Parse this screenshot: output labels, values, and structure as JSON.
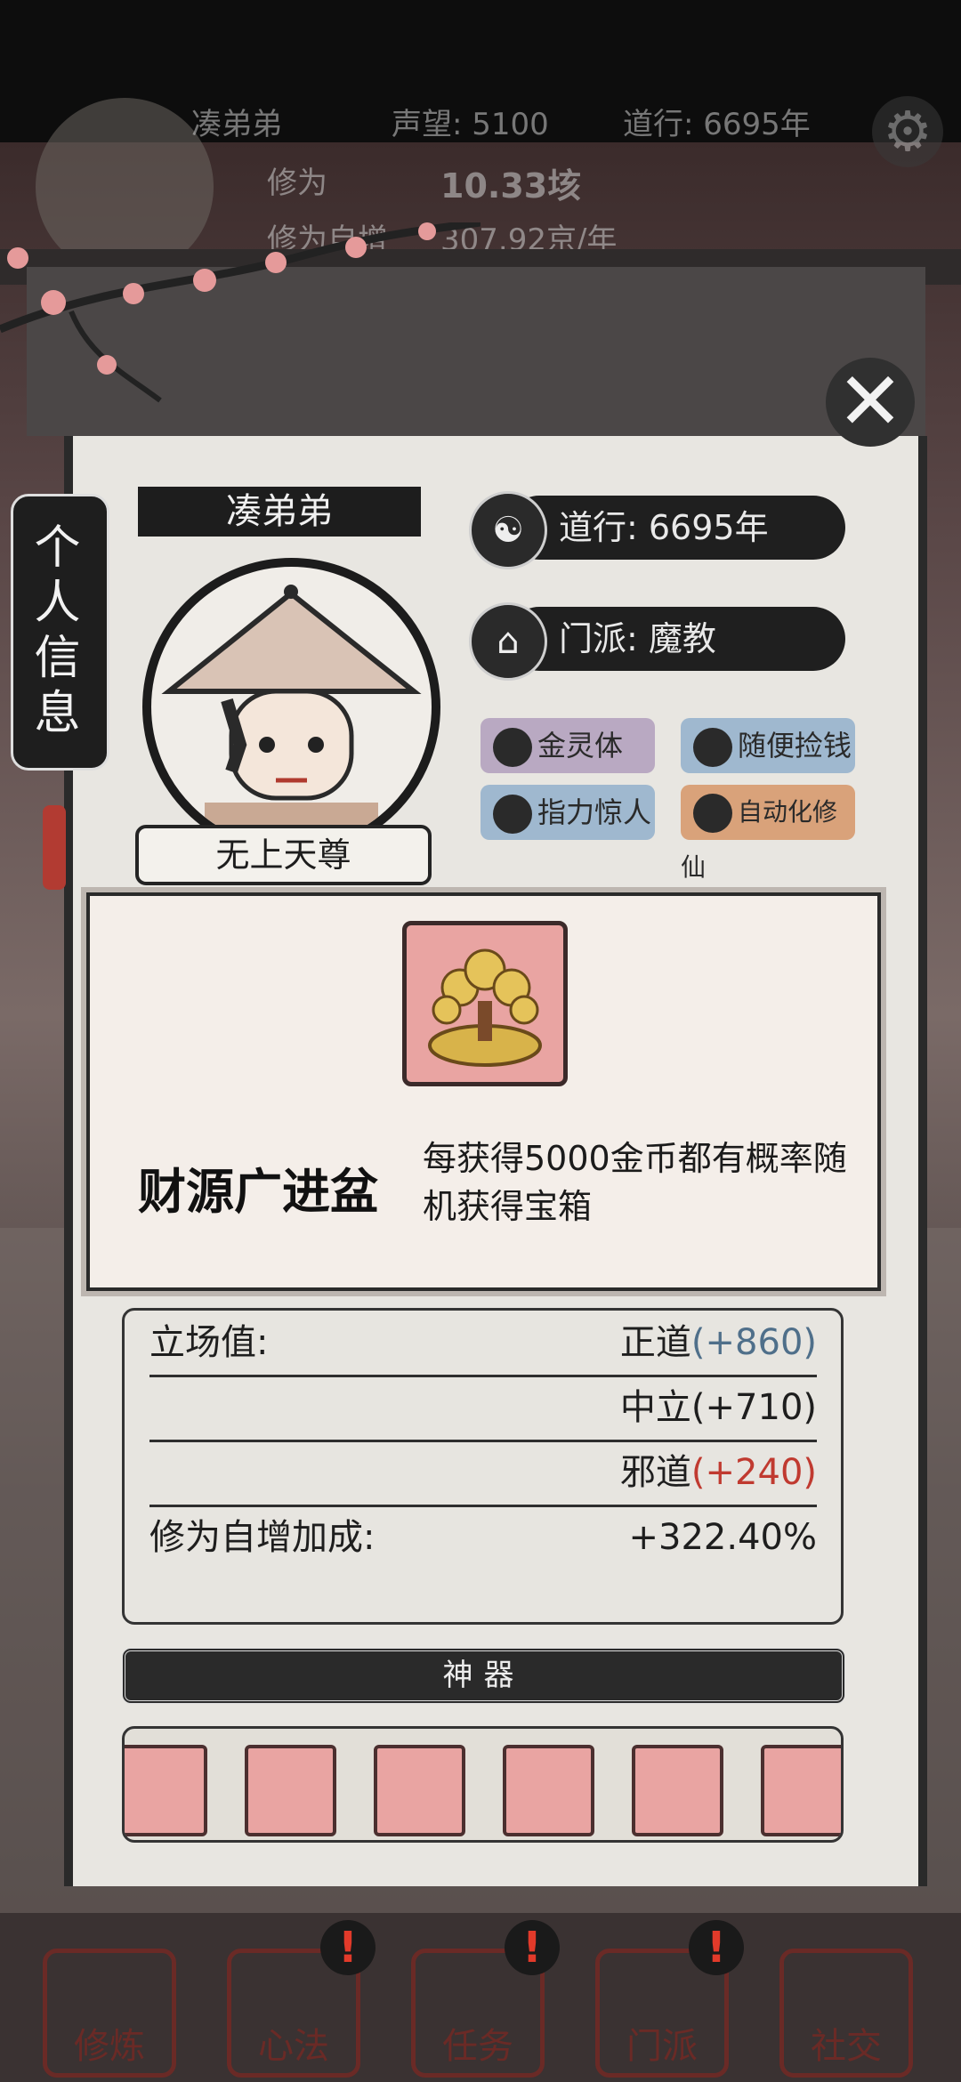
{
  "hud": {
    "player_name": "凑弟弟",
    "reputation": "声望: 5100",
    "cultivation_years": "道行: 6695年",
    "xiuwei_label": "修为",
    "xiuwei_value": "10.33垓",
    "auto_increase_label": "修为自增",
    "auto_increase_value": "307.92京/年"
  },
  "side_tab": {
    "label": "个\n人\n信\n息"
  },
  "profile": {
    "name": "凑弟弟",
    "rank_title": "无上天尊",
    "daoxing": "道行: 6695年",
    "sect": "门派: 魔教"
  },
  "traits": [
    "金灵体",
    "随便捡钱",
    "指力惊人",
    "自动化修仙"
  ],
  "popup": {
    "item_name": "财源广进盆",
    "item_desc": "每获得5000金币都有概率随机获得宝箱"
  },
  "stats": {
    "stance_label": "立场值:",
    "zhengdao_label": "正道",
    "zhengdao_value": "(+860)",
    "zhongli_label": "中立",
    "zhongli_value": "(+710)",
    "xiedao_label": "邪道",
    "xiedao_value": "(+240)",
    "bonus_label": "修为自增加成:",
    "bonus_value": "+322.40%"
  },
  "artifacts": {
    "header": "神器",
    "items": [
      "fan-icon",
      "golden-claw-icon",
      "jade-ring-icon",
      "token-icon",
      "money-tree-icon",
      "mirror-icon"
    ]
  },
  "bottom_nav": [
    "修炼",
    "心法",
    "任务",
    "门派",
    "社交"
  ],
  "colors": {
    "accent_blue": "#4f6f8a",
    "accent_red": "#c03a30",
    "seal_red": "#6a2a26"
  }
}
